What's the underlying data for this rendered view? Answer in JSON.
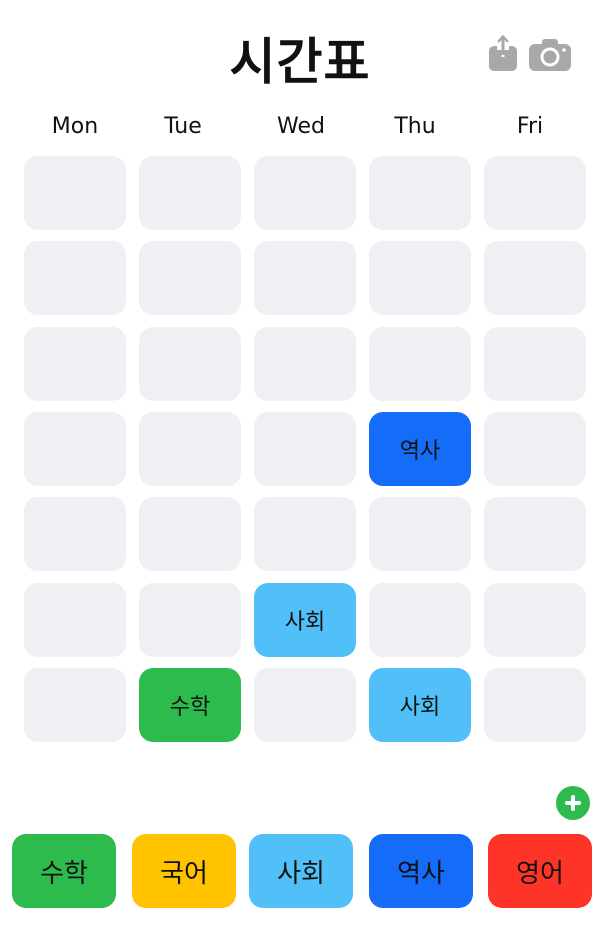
{
  "header": {
    "title": "시간표",
    "share_icon": "share-icon",
    "camera_icon": "camera-icon"
  },
  "days": [
    "Mon",
    "Tue",
    "Wed",
    "Thu",
    "Fri"
  ],
  "grid": [
    [
      "",
      "",
      "",
      "",
      ""
    ],
    [
      "",
      "",
      "",
      "",
      ""
    ],
    [
      "",
      "",
      "",
      "",
      ""
    ],
    [
      "",
      "",
      "",
      "역사",
      ""
    ],
    [
      "",
      "",
      "",
      "",
      ""
    ],
    [
      "",
      "",
      "사회",
      "",
      ""
    ],
    [
      "",
      "수학",
      "",
      "사회",
      ""
    ]
  ],
  "subjects": [
    {
      "name": "수학",
      "color": "#2dbb4e"
    },
    {
      "name": "국어",
      "color": "#ffc300"
    },
    {
      "name": "사회",
      "color": "#52c0f8"
    },
    {
      "name": "역사",
      "color": "#156cf8"
    },
    {
      "name": "영어",
      "color": "#ff3428"
    }
  ],
  "empty_color": "#efeff4",
  "add_button": "plus-icon"
}
